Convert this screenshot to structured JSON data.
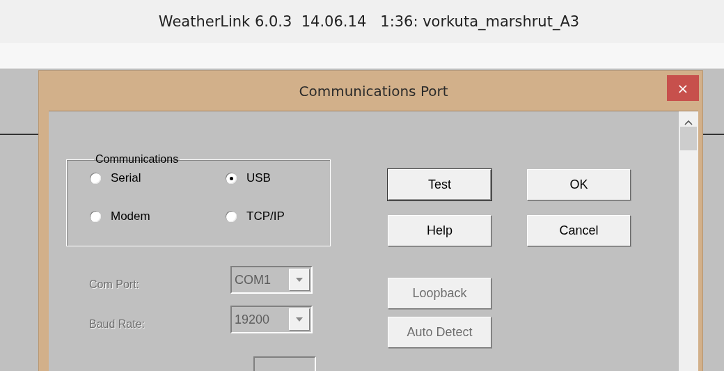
{
  "window": {
    "title": "WeatherLink 6.0.3  14.06.14   1:36: vorkuta_marshrut_A3"
  },
  "dialog": {
    "title": "Communications Port",
    "close": "×",
    "group": {
      "label": "Communications",
      "options": [
        {
          "label": "Serial",
          "selected": false
        },
        {
          "label": "USB",
          "selected": true
        },
        {
          "label": "Modem",
          "selected": false
        },
        {
          "label": "TCP/IP",
          "selected": false
        }
      ]
    },
    "buttons": [
      {
        "label": "Test",
        "default": true,
        "disabled": false
      },
      {
        "label": "OK",
        "default": false,
        "disabled": false
      },
      {
        "label": "Help",
        "default": false,
        "disabled": false
      },
      {
        "label": "Cancel",
        "default": false,
        "disabled": false
      },
      {
        "label": "Loopback",
        "default": false,
        "disabled": true
      },
      {
        "label": "Auto Detect",
        "default": false,
        "disabled": true
      }
    ],
    "fields": [
      {
        "label": "Com Port:",
        "value": "COM1",
        "disabled": true
      },
      {
        "label": "Baud Rate:",
        "value": "19200",
        "disabled": true
      }
    ]
  }
}
